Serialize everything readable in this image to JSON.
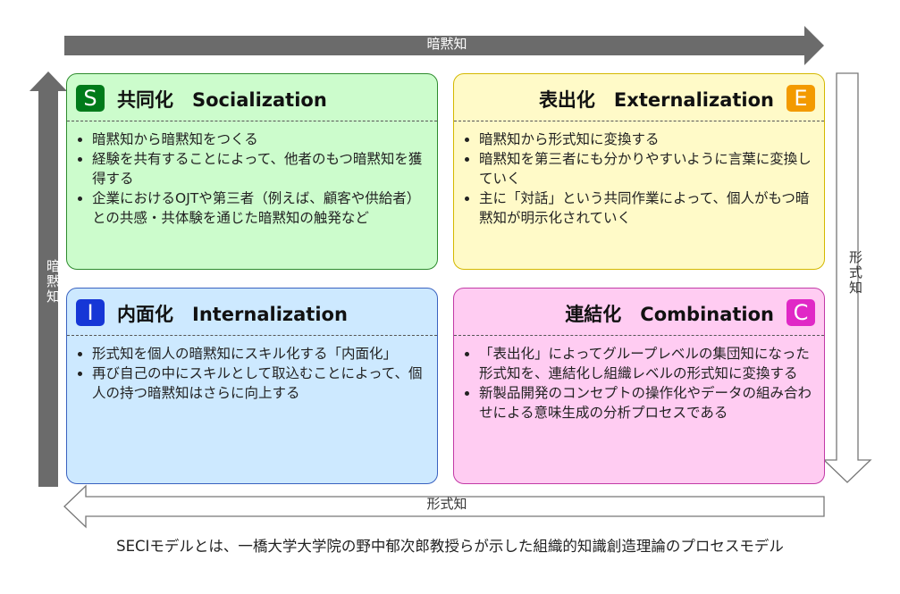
{
  "arrows": {
    "top": "暗黙知",
    "left": "暗黙知",
    "right": "形式知",
    "bottom": "形式知"
  },
  "quadrants": {
    "socialization": {
      "badge": "S",
      "title": "共同化　Socialization",
      "bullets": [
        "暗黙知から暗黙知をつくる",
        "経験を共有することによって、他者のもつ暗黙知を獲得する",
        "企業におけるOJTや第三者（例えば、顧客や供給者）との共感・共体験を通じた暗黙知の触発など"
      ]
    },
    "externalization": {
      "badge": "E",
      "title": "表出化　Externalization",
      "bullets": [
        "暗黙知から形式知に変換する",
        "暗黙知を第三者にも分かりやすいように言葉に変換していく",
        "主に「対話」という共同作業によって、個人がもつ暗黙知が明示化されていく"
      ]
    },
    "internalization": {
      "badge": "I",
      "title": "内面化　Internalization",
      "bullets": [
        "形式知を個人の暗黙知にスキル化する「内面化」",
        "再び自己の中にスキルとして取込むことによって、個人の持つ暗黙知はさらに向上する"
      ]
    },
    "combination": {
      "badge": "C",
      "title": "連結化　Combination",
      "bullets": [
        "「表出化」によってグループレベルの集団知になった形式知を、連結化し組織レベルの形式知に変換する",
        "新製品開発のコンセプトの操作化やデータの組み合わせによる意味生成の分析プロセスである"
      ]
    }
  },
  "footer": "SECIモデルとは、一橋大学大学院の野中郁次郎教授らが示した組織的知識創造理論のプロセスモデル",
  "colors": {
    "arrow_dark": "#6b6b6b",
    "s_badge": "#007a1a",
    "e_badge": "#f39a00",
    "i_badge": "#1636d6",
    "c_badge": "#e028c6"
  }
}
